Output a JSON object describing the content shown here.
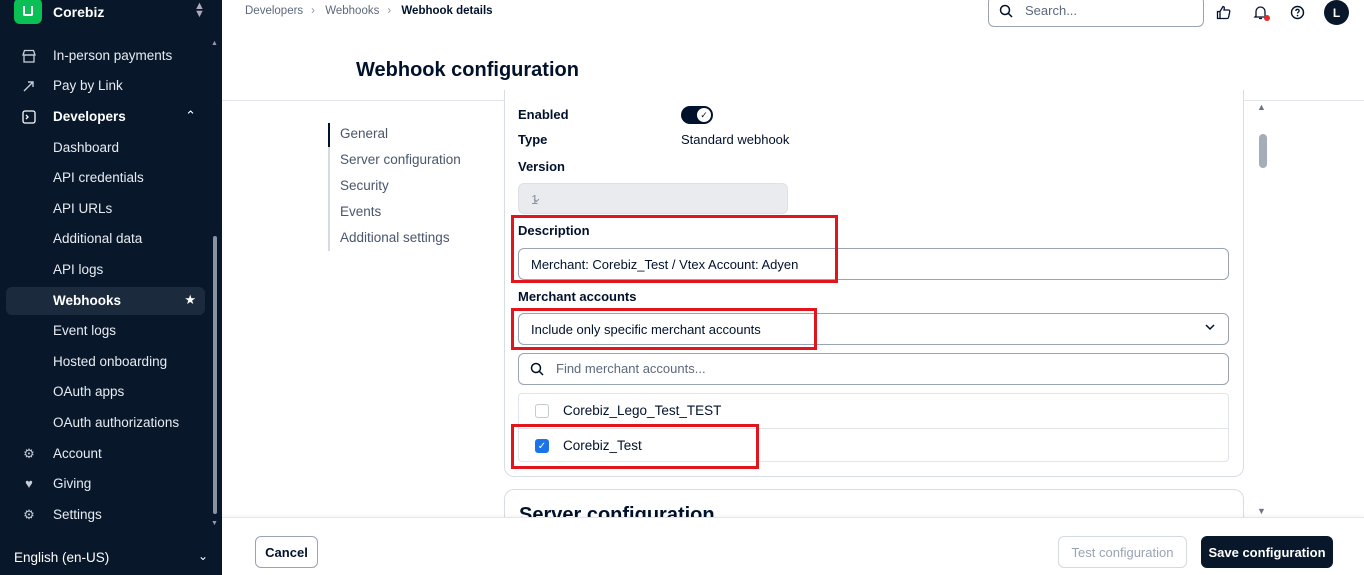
{
  "sidebar": {
    "company": "Corebiz",
    "items": [
      {
        "label": "In-person payments",
        "icon": "store-icon"
      },
      {
        "label": "Pay by Link",
        "icon": "rocket-icon"
      },
      {
        "label": "Developers",
        "icon": "terminal-icon"
      },
      {
        "label": "Dashboard"
      },
      {
        "label": "API credentials"
      },
      {
        "label": "API URLs"
      },
      {
        "label": "Additional data"
      },
      {
        "label": "API logs"
      },
      {
        "label": "Webhooks"
      },
      {
        "label": "Event logs"
      },
      {
        "label": "Hosted onboarding"
      },
      {
        "label": "OAuth apps"
      },
      {
        "label": "OAuth authorizations"
      },
      {
        "label": "Account",
        "icon": "gear-icon"
      },
      {
        "label": "Giving",
        "icon": "heart-icon"
      },
      {
        "label": "Settings",
        "icon": "gear-icon"
      }
    ],
    "active": "Webhooks",
    "language": "English (en-US)"
  },
  "breadcrumb": [
    "Developers",
    "Webhooks",
    "Webhook details"
  ],
  "search": {
    "placeholder": "Search..."
  },
  "user": {
    "initial": "L"
  },
  "page_title": "Webhook configuration",
  "section_nav": [
    "General",
    "Server configuration",
    "Security",
    "Events",
    "Additional settings"
  ],
  "general": {
    "enabled_label": "Enabled",
    "enabled": true,
    "type_label": "Type",
    "type_value": "Standard webhook",
    "version_label": "Version",
    "version_value": "1",
    "description_label": "Description",
    "description_value": "Merchant: Corebiz_Test / Vtex Account: Adyen",
    "merchant_accounts_label": "Merchant accounts",
    "merchant_accounts_value": "Include only specific merchant accounts",
    "find_placeholder": "Find merchant accounts...",
    "accounts": [
      {
        "name": "Corebiz_Lego_Test_TEST",
        "checked": false
      },
      {
        "name": "Corebiz_Test",
        "checked": true
      }
    ]
  },
  "next_section_title": "Server configuration",
  "footer": {
    "cancel": "Cancel",
    "test": "Test configuration",
    "save": "Save configuration"
  },
  "colors": {
    "accent": "#0abf53",
    "highlight": "#e0161c",
    "primary": "#08172a",
    "checkbox": "#1a73e8"
  }
}
